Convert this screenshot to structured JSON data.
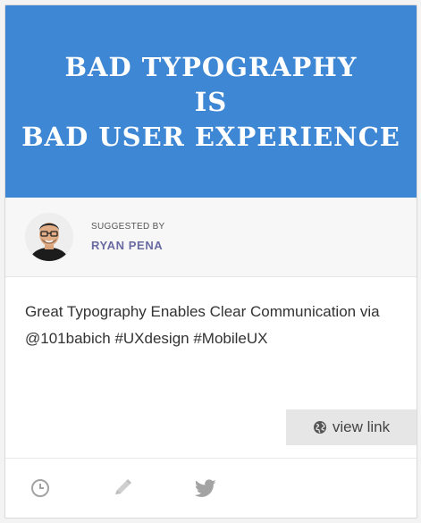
{
  "banner": {
    "line1": "BAD TYPOGRAPHY",
    "line2": "IS",
    "line3": "BAD USER EXPERIENCE",
    "bg_color": "#3e87d4"
  },
  "suggested": {
    "label": "SUGGESTED BY",
    "name": "RYAN PENA"
  },
  "post": {
    "text": "Great Typography Enables Clear Communication via @101babich #UXdesign #MobileUX"
  },
  "view_link": {
    "label": "view link",
    "icon": "globe-icon"
  },
  "footer": {
    "icons": [
      "clock-icon",
      "pencil-icon",
      "twitter-icon"
    ]
  }
}
